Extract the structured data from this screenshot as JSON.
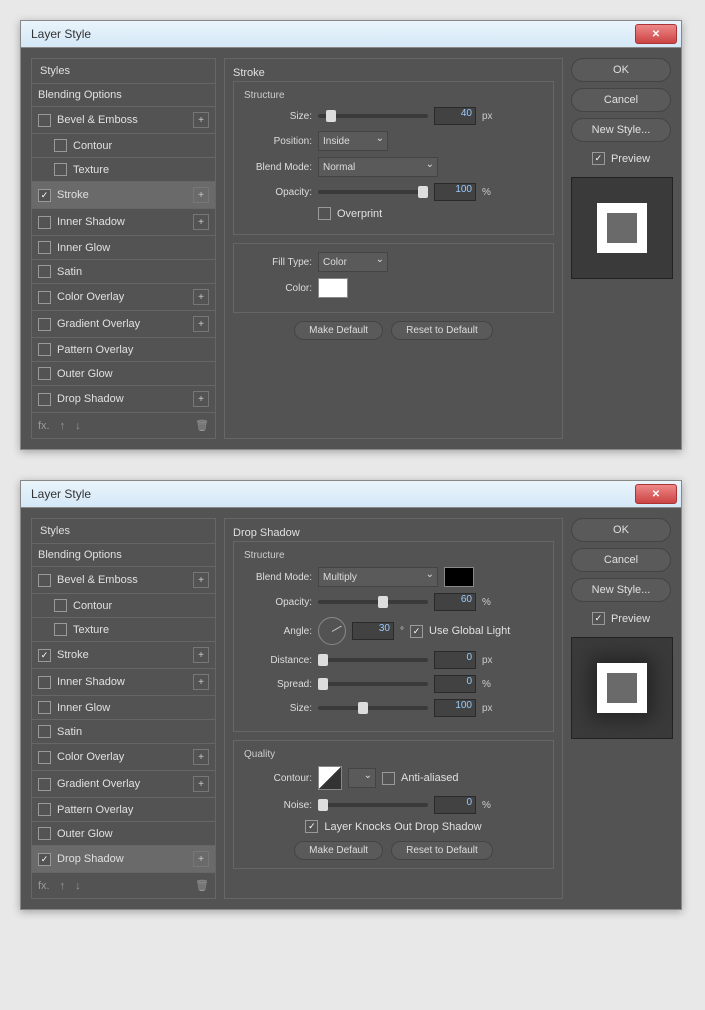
{
  "window_title": "Layer Style",
  "buttons": {
    "ok": "OK",
    "cancel": "Cancel",
    "newstyle": "New Style...",
    "preview": "Preview",
    "make_default": "Make Default",
    "reset_default": "Reset to Default"
  },
  "styles_header": "Styles",
  "styles": [
    {
      "label": "Blending Options"
    },
    {
      "label": "Bevel & Emboss",
      "cb": true,
      "plus": true
    },
    {
      "label": "Contour",
      "cb": true,
      "indent": true
    },
    {
      "label": "Texture",
      "cb": true,
      "indent": true
    },
    {
      "label": "Stroke",
      "cb": true,
      "plus": true
    },
    {
      "label": "Inner Shadow",
      "cb": true,
      "plus": true
    },
    {
      "label": "Inner Glow",
      "cb": true
    },
    {
      "label": "Satin",
      "cb": true
    },
    {
      "label": "Color Overlay",
      "cb": true,
      "plus": true
    },
    {
      "label": "Gradient Overlay",
      "cb": true,
      "plus": true
    },
    {
      "label": "Pattern Overlay",
      "cb": true
    },
    {
      "label": "Outer Glow",
      "cb": true
    },
    {
      "label": "Drop Shadow",
      "cb": true,
      "plus": true
    }
  ],
  "d1": {
    "panel_title": "Stroke",
    "structure": "Structure",
    "size_label": "Size:",
    "size_val": "40",
    "size_unit": "px",
    "position_label": "Position:",
    "position_val": "Inside",
    "blend_label": "Blend Mode:",
    "blend_val": "Normal",
    "opacity_label": "Opacity:",
    "opacity_val": "100",
    "opacity_unit": "%",
    "overprint": "Overprint",
    "fill_label": "Fill Type:",
    "fill_val": "Color",
    "color_label": "Color:",
    "color_hex": "#ffffff",
    "selected": "Stroke",
    "checked": [
      "Stroke"
    ]
  },
  "d2": {
    "panel_title": "Drop Shadow",
    "structure": "Structure",
    "blend_label": "Blend Mode:",
    "blend_val": "Multiply",
    "blend_color": "#000000",
    "opacity_label": "Opacity:",
    "opacity_val": "60",
    "opacity_unit": "%",
    "angle_label": "Angle:",
    "angle_val": "30",
    "angle_unit": "°",
    "use_global": "Use Global Light",
    "distance_label": "Distance:",
    "distance_val": "0",
    "distance_unit": "px",
    "spread_label": "Spread:",
    "spread_val": "0",
    "spread_unit": "%",
    "size_label": "Size:",
    "size_val": "100",
    "size_unit": "px",
    "quality": "Quality",
    "contour_label": "Contour:",
    "antialiased": "Anti-aliased",
    "noise_label": "Noise:",
    "noise_val": "0",
    "noise_unit": "%",
    "knockout": "Layer Knocks Out Drop Shadow",
    "selected": "Drop Shadow",
    "checked": [
      "Stroke",
      "Drop Shadow"
    ]
  }
}
